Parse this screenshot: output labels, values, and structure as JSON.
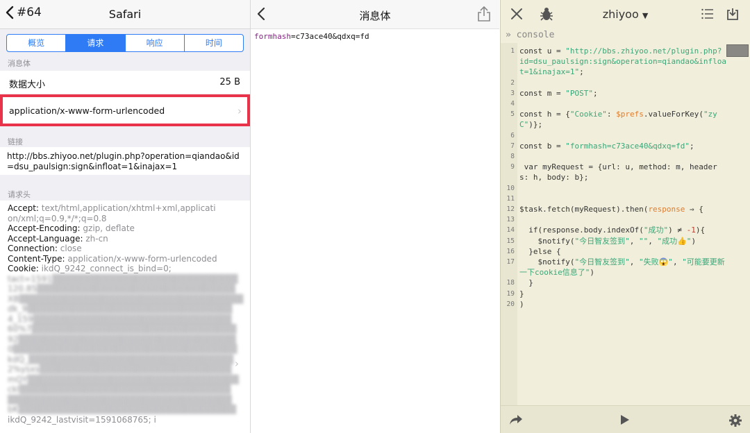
{
  "left": {
    "nav": {
      "back_label": "#64",
      "title": "Safari"
    },
    "tabs": [
      "概览",
      "请求",
      "响应",
      "时间"
    ],
    "active_tab": "请求",
    "section_body": "消息体",
    "data_size_label": "数据大小",
    "data_size_value": "25 B",
    "content_type": "application/x-www-form-urlencoded",
    "section_link": "链接",
    "url": "http://bbs.zhiyoo.net/plugin.php?operation=qiandao&id=dsu_paulsign:sign&infloat=1&inajax=1",
    "section_headers": "请求头",
    "headers": [
      {
        "key": "Accept:",
        "value": "text/html,application/xhtml+xml,application/xml;q=0.9,*/*;q=0.8"
      },
      {
        "key": "Accept-Encoding:",
        "value": "gzip, deflate"
      },
      {
        "key": "Accept-Language:",
        "value": "zh-cn"
      },
      {
        "key": "Connection:",
        "value": "close"
      },
      {
        "key": "Content-Type:",
        "value": "application/x-www-form-urlencoded"
      },
      {
        "key": "Cookie:",
        "value": "ikdQ_9242_connect_is_bind=0;"
      }
    ],
    "cookie_tail": "ikdQ_9242_lastvisit=1591068765; i"
  },
  "middle": {
    "nav": {
      "title": "消息体"
    },
    "body_key": "formhash",
    "body_value": "=c73ace40&qdxq=fd"
  },
  "right": {
    "nav": {
      "title": "zhiyoo"
    },
    "console_label": "» console",
    "lines": [
      {
        "n": "1",
        "html": "const u = <span class=\"c-str\">\"http://bbs.zhiyoo.net/plugin.php?id=dsu_paulsign:sign&operation=qiandao&infloat=1&inajax=1\"</span>;"
      },
      {
        "n": "2",
        "html": ""
      },
      {
        "n": "3",
        "html": "const m = <span class=\"c-str\">\"POST\"</span>;"
      },
      {
        "n": "4",
        "html": ""
      },
      {
        "n": "5",
        "html": "const h = {<span class=\"c-str\">\"Cookie\"</span>: <span class=\"c-var\">$prefs</span>.valueForKey(<span class=\"c-str\">\"zyC\"</span>)};"
      },
      {
        "n": "6",
        "html": ""
      },
      {
        "n": "7",
        "html": "const b = <span class=\"c-str\">\"formhash=c73ace40&qdxq=fd\"</span>;"
      },
      {
        "n": "8",
        "html": ""
      },
      {
        "n": "9",
        "html": " var myRequest = {url: u, method: m, headers: h, body: b};"
      },
      {
        "n": "10",
        "html": ""
      },
      {
        "n": "11",
        "html": ""
      },
      {
        "n": "12",
        "html": "$task.fetch(myRequest).then(<span class=\"c-var\">response</span> ⇒ {"
      },
      {
        "n": "13",
        "html": ""
      },
      {
        "n": "14",
        "html": "  if(response.body.indexOf(<span class=\"c-str\">\"成功\"</span>) ≠ <span class=\"c-num\">-1</span>){"
      },
      {
        "n": "15",
        "html": "    $notify(<span class=\"c-str\">\"今日智友签到\"</span>, <span class=\"c-str\">\"\"</span>, <span class=\"c-str\">\"成功👍\"</span>)"
      },
      {
        "n": "16",
        "html": "  }else {"
      },
      {
        "n": "17",
        "html": "    $notify(<span class=\"c-str\">\"今日智友签到\"</span>, <span class=\"c-str\">\"失败😱\"</span>, <span class=\"c-str\">\"可能要更新一下cookie信息了\"</span>)"
      },
      {
        "n": "18",
        "html": "  }"
      },
      {
        "n": "19",
        "html": "}"
      },
      {
        "n": "20",
        "html": ")"
      }
    ]
  }
}
